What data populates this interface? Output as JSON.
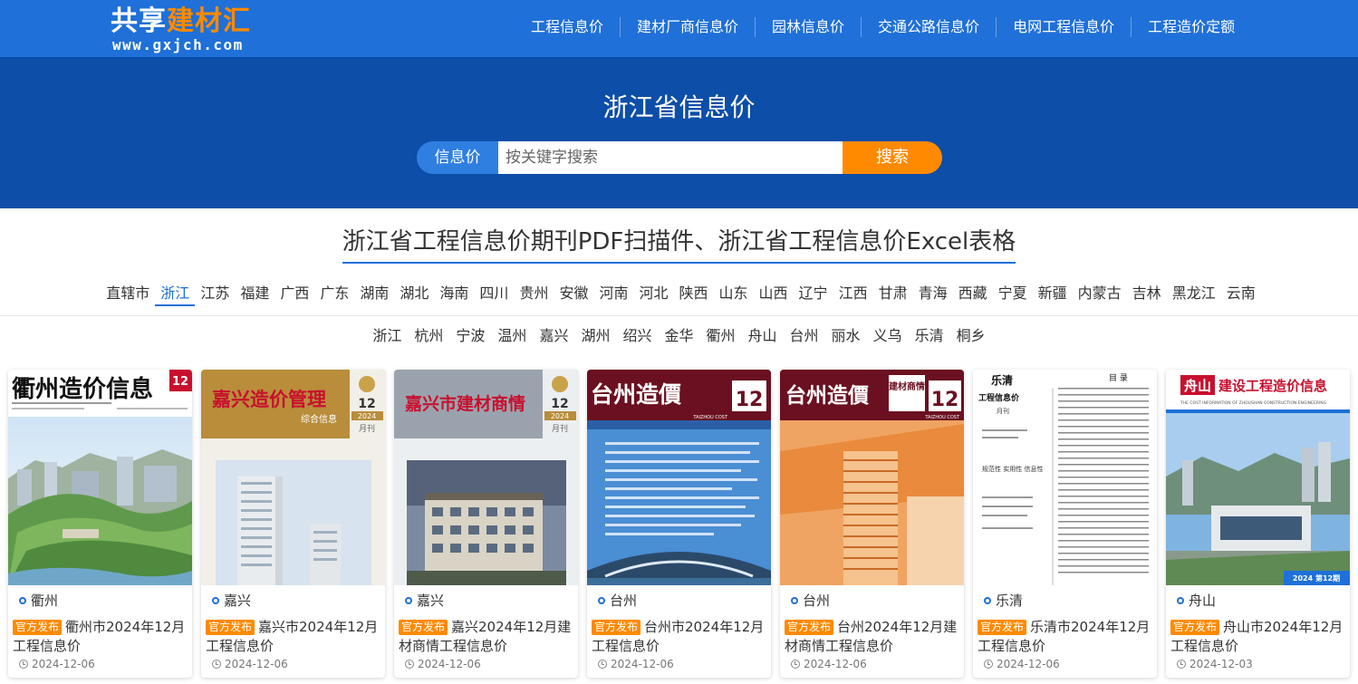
{
  "header": {
    "logo_title_white": "共享",
    "logo_title_orange": "建材汇",
    "logo_url": "www.gxjch.com",
    "nav": [
      "工程信息价",
      "建材厂商信息价",
      "园林信息价",
      "交通公路信息价",
      "电网工程信息价",
      "工程造价定额"
    ]
  },
  "hero": {
    "title": "浙江省信息价",
    "search_type": "信息价",
    "search_placeholder": "按关键字搜索",
    "search_button": "搜索"
  },
  "section": {
    "title": "浙江省工程信息价期刊PDF扫描件、浙江省工程信息价Excel表格"
  },
  "provinces": [
    "直辖市",
    "浙江",
    "江苏",
    "福建",
    "广西",
    "广东",
    "湖南",
    "湖北",
    "海南",
    "四川",
    "贵州",
    "安徽",
    "河南",
    "河北",
    "陕西",
    "山东",
    "山西",
    "辽宁",
    "江西",
    "甘肃",
    "青海",
    "西藏",
    "宁夏",
    "新疆",
    "内蒙古",
    "吉林",
    "黑龙江",
    "云南"
  ],
  "active_province": "浙江",
  "cities": [
    "浙江",
    "杭州",
    "宁波",
    "温州",
    "嘉兴",
    "湖州",
    "绍兴",
    "金华",
    "衢州",
    "舟山",
    "台州",
    "丽水",
    "义乌",
    "乐清",
    "桐乡"
  ],
  "badge_label": "官方发布",
  "cards": [
    {
      "city": "衢州",
      "title": "衢州市2024年12月工程信息价",
      "date": "2024-12-06",
      "cover_title": "衢州造价信息",
      "cover_issue": "12"
    },
    {
      "city": "嘉兴",
      "title": "嘉兴市2024年12月工程信息价",
      "date": "2024-12-06",
      "cover_title": "嘉兴造价管理",
      "cover_sub": "综合信息",
      "cover_issue": "12",
      "cover_year": "2024",
      "cover_freq": "月刊"
    },
    {
      "city": "嘉兴",
      "title": "嘉兴2024年12月建材商情工程信息价",
      "date": "2024-12-06",
      "cover_title": "嘉兴市建材商情",
      "cover_issue": "12",
      "cover_year": "2024",
      "cover_freq": "月刊"
    },
    {
      "city": "台州",
      "title": "台州市2024年12月工程信息价",
      "date": "2024-12-06",
      "cover_title": "台州造價",
      "cover_issue": "12",
      "cover_en": "TAIZHOU COST"
    },
    {
      "city": "台州",
      "title": "台州2024年12月建材商情工程信息价",
      "date": "2024-12-06",
      "cover_title": "台州造價",
      "cover_sub": "建材商情",
      "cover_issue": "12",
      "cover_en": "TAIZHOU COST"
    },
    {
      "city": "乐清",
      "title": "乐清市2024年12月工程信息价",
      "date": "2024-12-06",
      "cover_title": "乐清",
      "cover_sub": "工程信息价",
      "cover_freq": "月刊",
      "cover_toc": "目 录",
      "cover_tags": "规范性 实用性 信息性"
    },
    {
      "city": "舟山",
      "title": "舟山市2024年12月工程信息价",
      "date": "2024-12-03",
      "cover_title_red": "舟山",
      "cover_title": "建设工程造价信息",
      "cover_en": "THE COST INFORMATION OF ZHOUSHAN CONSTRUCTION ENGINEERING",
      "cover_issue": "2024 第12期"
    }
  ],
  "colors": {
    "topbar": "#1f70d8",
    "hero": "#0c4ea8",
    "accent_orange": "#ff8a00",
    "active_blue": "#1f70d8"
  }
}
